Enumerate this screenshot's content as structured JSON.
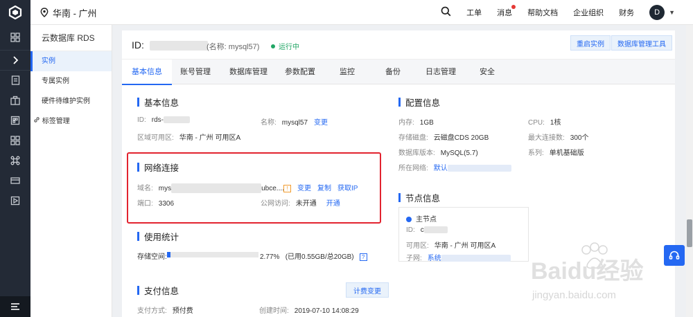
{
  "topbar": {
    "region": "华南 - 广州",
    "nav": [
      "工单",
      "消息",
      "帮助文档",
      "企业组织",
      "财务"
    ],
    "avatar_letter": "D"
  },
  "sidebar": {
    "title": "云数据库 RDS",
    "items": [
      "实例",
      "专属实例",
      "硬件待维护实例",
      "标签管理"
    ]
  },
  "header": {
    "id_label": "ID:",
    "alias": "(名称: mysql57)",
    "status": "运行中",
    "restart_btn": "重启实例",
    "dbtool_btn": "数据库管理工具"
  },
  "tabs": [
    "基本信息",
    "账号管理",
    "数据库管理",
    "参数配置",
    "监控",
    "备份",
    "日志管理",
    "安全"
  ],
  "basic": {
    "title": "基本信息",
    "id_label": "ID:",
    "id_value": "rds-",
    "name_label": "名称:",
    "name_value": "mysql57",
    "change": "变更",
    "zone_label": "区域可用区:",
    "zone_value": "华南 - 广州 可用区A"
  },
  "network": {
    "title": "网络连接",
    "domain_label": "域名:",
    "domain_prefix": "mys",
    "domain_suffix": "ubce....",
    "warn": "!",
    "change": "变更",
    "copy": "复制",
    "get_ip": "获取IP",
    "port_label": "端口:",
    "port_value": "3306",
    "public_label": "公网访问:",
    "public_value": "未开通",
    "open": "开通"
  },
  "usage": {
    "title": "使用统计",
    "storage_label": "存储空间:",
    "percent_text": "2.77%",
    "used_fraction": 0.0277,
    "detail": "(已用0.55GB/总20GB)",
    "help": "?"
  },
  "payment": {
    "title": "支付信息",
    "plan_btn": "计费变更",
    "method_label": "支付方式:",
    "method_value": "预付费",
    "created_label": "创建时间:",
    "created_value": "2019-07-10 14:08:29"
  },
  "config": {
    "title": "配置信息",
    "memory_label": "内存:",
    "memory_value": "1GB",
    "cpu_label": "CPU:",
    "cpu_value": "1核",
    "disk_label": "存储磁盘:",
    "disk_value": "云磁盘CDS 20GB",
    "maxconn_label": "最大连接数:",
    "maxconn_value": "300个",
    "version_label": "数据库版本:",
    "version_value": "MySQL(5.7)",
    "series_label": "系列:",
    "series_value": "单机基础版",
    "network_label": "所在网络:",
    "network_value": "默认"
  },
  "node": {
    "title": "节点信息",
    "primary": "主节点",
    "id_label": "ID:",
    "id_value": "c",
    "zone_label": "可用区:",
    "zone_value": "华南 - 广州 可用区A",
    "subnet_label": "子网:",
    "subnet_value": "系统"
  },
  "watermark": {
    "brand": "Baidu经验",
    "site": "jingyan.baidu.com"
  }
}
